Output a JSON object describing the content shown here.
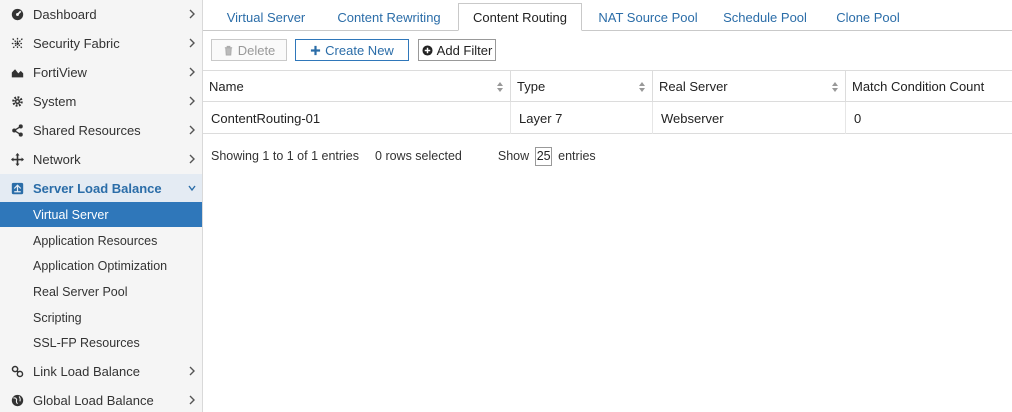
{
  "sidebar": {
    "items": [
      {
        "label": "Dashboard",
        "icon": "dashboard-icon"
      },
      {
        "label": "Security Fabric",
        "icon": "security-fabric-icon"
      },
      {
        "label": "FortiView",
        "icon": "fortiview-icon"
      },
      {
        "label": "System",
        "icon": "gear-icon"
      },
      {
        "label": "Shared Resources",
        "icon": "share-icon"
      },
      {
        "label": "Network",
        "icon": "network-icon"
      },
      {
        "label": "Server Load Balance",
        "icon": "server-load-balance-icon",
        "expanded": true
      },
      {
        "label": "Link Load Balance",
        "icon": "link-icon"
      },
      {
        "label": "Global Load Balance",
        "icon": "globe-icon"
      }
    ],
    "sub_items": [
      {
        "label": "Virtual Server",
        "active": true
      },
      {
        "label": "Application Resources"
      },
      {
        "label": "Application Optimization"
      },
      {
        "label": "Real Server Pool"
      },
      {
        "label": "Scripting"
      },
      {
        "label": "SSL-FP Resources"
      }
    ]
  },
  "tabs": [
    {
      "label": "Virtual Server"
    },
    {
      "label": "Content Rewriting"
    },
    {
      "label": "Content Routing",
      "active": true
    },
    {
      "label": "NAT Source Pool"
    },
    {
      "label": "Schedule Pool"
    },
    {
      "label": "Clone Pool"
    }
  ],
  "toolbar": {
    "delete_label": "Delete",
    "create_label": "Create New",
    "filter_label": "Add Filter"
  },
  "table": {
    "columns": [
      "Name",
      "Type",
      "Real Server",
      "Match Condition Count"
    ],
    "rows": [
      [
        "ContentRouting-01",
        "Layer 7",
        "Webserver",
        "0"
      ]
    ]
  },
  "footer": {
    "showing": "Showing 1 to 1 of 1 entries",
    "selected": "0 rows selected",
    "show_label": "Show",
    "page_size": "25",
    "entries_label": "entries"
  },
  "colors": {
    "accent": "#2b6da8",
    "active_bg": "#2f77ba",
    "expanded_bg": "#e4ebf3"
  }
}
